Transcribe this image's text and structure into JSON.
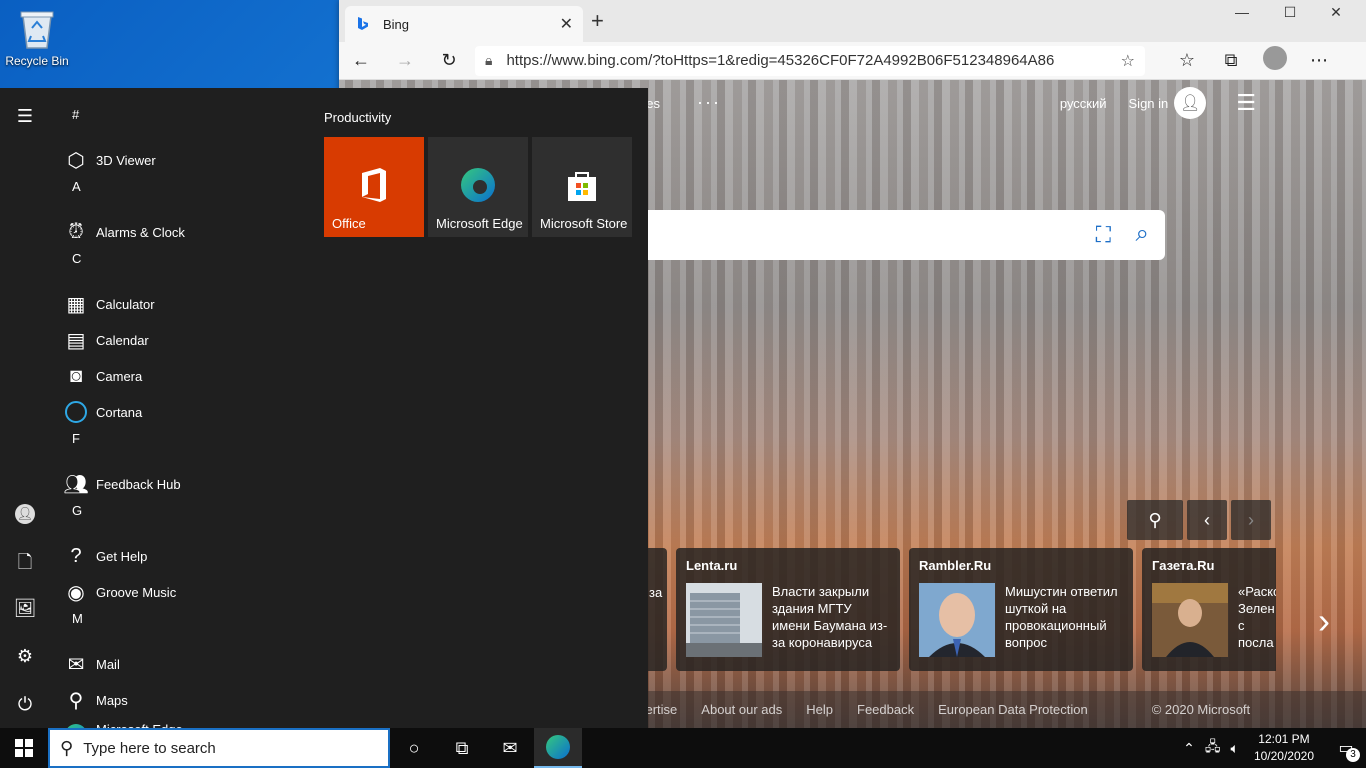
{
  "desktop": {
    "recycle_bin": "Recycle Bin"
  },
  "browser": {
    "tab_title": "Bing",
    "address_url": "https://www.bing.com/?toHttps=1&redig=45326CF0F72A4992B06F512348964A86",
    "bing": {
      "lang": "русский",
      "signin": "Sign in",
      "images_partial": "ges",
      "news": [
        {
          "source": "",
          "headline": "за"
        },
        {
          "source": "Lenta.ru",
          "headline": "Власти закрыли здания МГТУ имени Баумана из-за коронавируса"
        },
        {
          "source": "Rambler.Ru",
          "headline": "Мишустин ответил шуткой на провокационный вопрос"
        },
        {
          "source": "Газета.Ru",
          "headline": "«Раско Зелен с посла"
        }
      ],
      "footer": {
        "advertise": "vertise",
        "about": "About our ads",
        "help": "Help",
        "feedback": "Feedback",
        "privacy": "European Data Protection",
        "copyright": "© 2020 Microsoft"
      }
    }
  },
  "start_menu": {
    "sections": [
      {
        "letter": "#",
        "apps": [
          "3D Viewer"
        ]
      },
      {
        "letter": "A",
        "apps": [
          "Alarms & Clock"
        ]
      },
      {
        "letter": "C",
        "apps": [
          "Calculator",
          "Calendar",
          "Camera",
          "Cortana"
        ]
      },
      {
        "letter": "F",
        "apps": [
          "Feedback Hub"
        ]
      },
      {
        "letter": "G",
        "apps": [
          "Get Help",
          "Groove Music"
        ]
      },
      {
        "letter": "M",
        "apps": [
          "Mail",
          "Maps",
          "Microsoft Edge"
        ]
      }
    ],
    "tiles_group": "Productivity",
    "tiles": [
      {
        "label": "Office",
        "color": "#d83b01"
      },
      {
        "label": "Microsoft Edge",
        "color": "#2f2f2f"
      },
      {
        "label": "Microsoft Store",
        "color": "#2f2f2f"
      }
    ]
  },
  "taskbar": {
    "search_placeholder": "Type here to search",
    "time": "12:01 PM",
    "date": "10/20/2020",
    "notification_count": "3"
  }
}
